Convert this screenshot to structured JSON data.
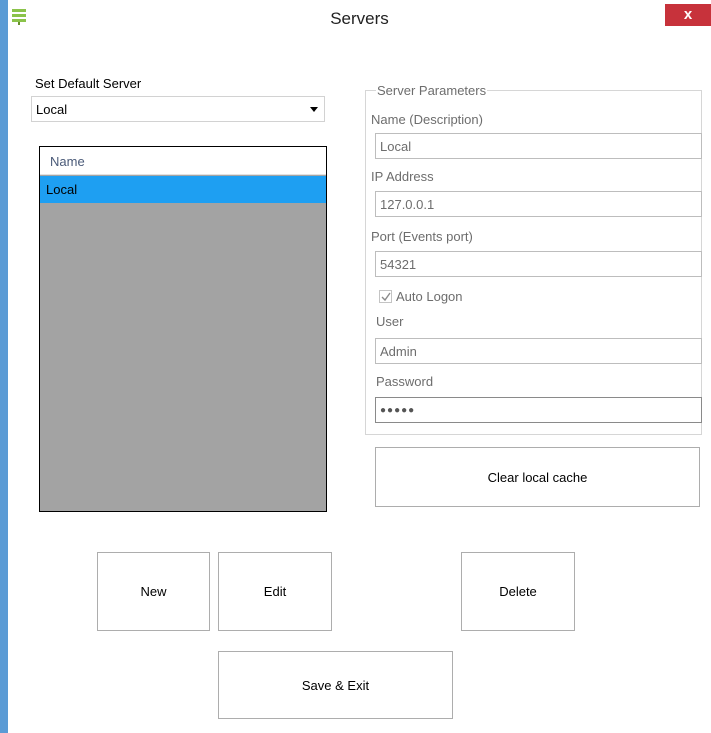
{
  "window": {
    "title": "Servers",
    "close_glyph": "x",
    "icon": "server-app-icon"
  },
  "default_server": {
    "label": "Set Default Server",
    "selected": "Local"
  },
  "server_list": {
    "column_header": "Name",
    "rows": [
      "Local"
    ],
    "selected_index": 0
  },
  "server_parameters": {
    "legend": "Server Parameters",
    "name_label": "Name (Description)",
    "name_value": "Local",
    "ip_label": "IP Address",
    "ip_value": "127.0.0.1",
    "port_label": "Port (Events port)",
    "port_value": "54321",
    "auto_logon_label": "Auto Logon",
    "auto_logon_checked": true,
    "user_label": "User",
    "user_value": "Admin",
    "password_label": "Password",
    "password_value": "●●●●●"
  },
  "buttons": {
    "clear_cache": "Clear local cache",
    "new": "New",
    "edit": "Edit",
    "delete": "Delete",
    "save_exit": "Save & Exit"
  },
  "colors": {
    "selection": "#1e9ff2",
    "close_button": "#c7323b",
    "window_border": "#5b9bd5",
    "list_background": "#a3a3a3"
  }
}
